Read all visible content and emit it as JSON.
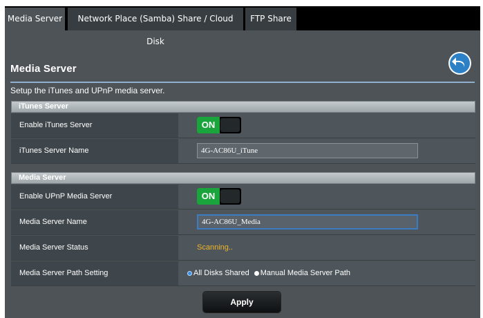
{
  "tabs": [
    {
      "label": "Media Server",
      "active": true
    },
    {
      "label": "Network Place (Samba) Share / Cloud Disk",
      "active": false
    },
    {
      "label": "FTP Share",
      "active": false
    }
  ],
  "page": {
    "title": "Media Server",
    "description": "Setup the iTunes and UPnP media server.",
    "back_icon": "back-arrow-icon"
  },
  "itunes_section": {
    "header": "iTunes Server",
    "enable_label": "Enable iTunes Server",
    "enable_toggle": "ON",
    "name_label": "iTunes Server Name",
    "name_value": "4G-AC86U_iTune"
  },
  "media_section": {
    "header": "Media Server",
    "enable_label": "Enable UPnP Media Server",
    "enable_toggle": "ON",
    "name_label": "Media Server Name",
    "name_value": "4G-AC86U_Media",
    "status_label": "Media Server Status",
    "status_value": "Scanning..",
    "path_label": "Media Server Path Setting",
    "path_options": [
      "All Disks Shared",
      "Manual Media Server Path"
    ],
    "path_selected": "All Disks Shared"
  },
  "actions": {
    "apply_label": "Apply"
  },
  "colors": {
    "accent_blue": "#2b80c6",
    "toggle_on": "#1aa53c",
    "status_text": "#f0b428",
    "panel_bg": "#4d5357"
  }
}
